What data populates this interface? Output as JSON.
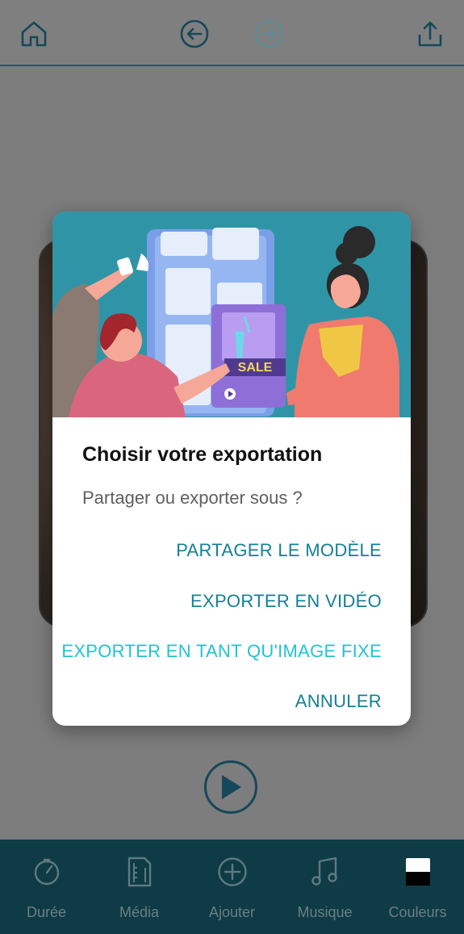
{
  "toolbar": {
    "home_icon": "home-icon",
    "undo_icon": "undo-icon",
    "redo_icon": "redo-icon",
    "share_icon": "share-icon"
  },
  "dialog": {
    "title": "Choisir votre exportation",
    "message": "Partager ou exporter sous ?",
    "actions": [
      "PARTAGER LE MODÈLE",
      "EXPORTER EN VIDÉO",
      "EXPORTER EN TANT QU'IMAGE FIXE",
      "ANNULER"
    ],
    "illustration_text": "SALE"
  },
  "bottom_nav": [
    {
      "label": "Durée",
      "icon": "timer-icon"
    },
    {
      "label": "Média",
      "icon": "film-icon"
    },
    {
      "label": "Ajouter",
      "icon": "add-circle-icon"
    },
    {
      "label": "Musique",
      "icon": "music-note-icon"
    },
    {
      "label": "Couleurs",
      "icon": "color-swatch-icon"
    }
  ],
  "colors": {
    "accent": "#157f96",
    "accent_alt": "#21c3d3",
    "nav_bg": "#0e3b45",
    "icon_dark": "#15485a"
  }
}
